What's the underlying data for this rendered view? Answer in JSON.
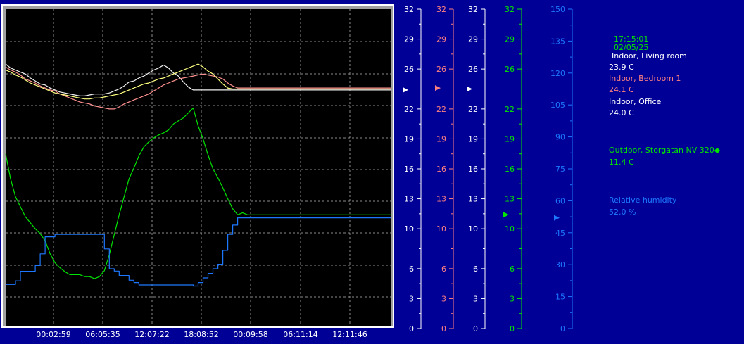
{
  "colors": {
    "background": "#000096",
    "plot_background": "#000000",
    "grid": "#8a8a8a",
    "living_room": "#f0f0f0",
    "bedroom": "#ff9090",
    "office": "#ffff80",
    "outdoor": "#00e600",
    "humidity": "#1e78ff"
  },
  "readouts": {
    "time": "17:15:01",
    "date": "02/05/25",
    "sensors": [
      {
        "name": "Indoor, Living room",
        "value": "23.9  C",
        "color": "#ffffff"
      },
      {
        "name": "Indoor, Bedroom 1",
        "value": "24.1  C",
        "color": "#ff8080"
      },
      {
        "name": "Indoor, Office",
        "value": "24.0  C",
        "color": "#ffffff"
      },
      {
        "name": "Outdoor, Storgatan NV 320◆",
        "value": "11.4  C",
        "color": "#00e600"
      },
      {
        "name": "Relative humidity",
        "value": "52.0 %",
        "color": "#1e78ff"
      }
    ]
  },
  "chart_data": {
    "type": "line",
    "x_ticks": [
      "00:02:59",
      "06:05:35",
      "12:07:22",
      "18:08:52",
      "00:09:58",
      "06:11:14",
      "12:11:46"
    ],
    "x": [
      0,
      1,
      2,
      3,
      4,
      5,
      6,
      7,
      8,
      9,
      10,
      11,
      12,
      13,
      14,
      15,
      16,
      17,
      18,
      19,
      20,
      21,
      22,
      23,
      24,
      25,
      26,
      27,
      28,
      29,
      30,
      31,
      32,
      33,
      34,
      35,
      36,
      37,
      38,
      39,
      40,
      41,
      42,
      43,
      44,
      45,
      46,
      47,
      48,
      49,
      50,
      51,
      52,
      53,
      54,
      55,
      56,
      57,
      58,
      59,
      60,
      61,
      62,
      63,
      64,
      65,
      66,
      67,
      68,
      69,
      70,
      71,
      72,
      73,
      74,
      75,
      76,
      77,
      78
    ],
    "xlim": [
      0,
      78
    ],
    "axes": [
      {
        "color": "#ffffff",
        "ylim": [
          0,
          32
        ],
        "ticks": [
          0,
          3,
          6,
          10,
          13,
          16,
          19,
          22,
          26,
          29,
          32
        ],
        "marker": 23.9
      },
      {
        "color": "#ff8080",
        "ylim": [
          0,
          32
        ],
        "ticks": [
          0,
          3,
          6,
          10,
          13,
          16,
          19,
          22,
          26,
          29,
          32
        ],
        "marker": 24.1
      },
      {
        "color": "#ffffff",
        "ylim": [
          0,
          32
        ],
        "ticks": [
          0,
          3,
          6,
          10,
          13,
          16,
          19,
          22,
          26,
          29,
          32
        ],
        "marker": 24.0
      },
      {
        "color": "#00e600",
        "ylim": [
          0,
          32
        ],
        "ticks": [
          0,
          3,
          6,
          10,
          13,
          16,
          19,
          22,
          26,
          29,
          32
        ],
        "marker": 11.4
      },
      {
        "color": "#1e78ff",
        "ylim": [
          0,
          150
        ],
        "ticks": [
          0,
          15,
          30,
          45,
          60,
          75,
          90,
          105,
          120,
          135,
          150
        ],
        "marker": 52.0
      }
    ],
    "series": [
      {
        "name": "Indoor, Living room",
        "axis": 0,
        "color": "#f0f0f0",
        "values": [
          26.5,
          26.1,
          25.9,
          25.7,
          25.5,
          25.1,
          24.8,
          24.5,
          24.4,
          24.1,
          23.9,
          23.7,
          23.6,
          23.5,
          23.4,
          23.3,
          23.3,
          23.4,
          23.5,
          23.5,
          23.5,
          23.6,
          23.8,
          24.0,
          24.3,
          24.7,
          24.8,
          25.1,
          25.3,
          25.6,
          25.9,
          26.1,
          26.4,
          26.1,
          25.6,
          25.3,
          24.7,
          24.2,
          23.9,
          23.9,
          23.9,
          23.9,
          23.9,
          23.9,
          23.9,
          23.9,
          23.9,
          23.9,
          23.9,
          23.9,
          23.9,
          23.9,
          23.9,
          23.9,
          23.9,
          23.9,
          23.9,
          23.9,
          23.9,
          23.9,
          23.9,
          23.9,
          23.9,
          23.9,
          23.9,
          23.9,
          23.9,
          23.9,
          23.9,
          23.9,
          23.9,
          23.9,
          23.9,
          23.9,
          23.9,
          23.9,
          23.9,
          23.9,
          23.9
        ]
      },
      {
        "name": "Indoor, Bedroom 1",
        "axis": 1,
        "color": "#ff9090",
        "values": [
          26.2,
          25.9,
          25.7,
          25.4,
          25.0,
          24.8,
          24.6,
          24.3,
          24.1,
          23.9,
          23.8,
          23.5,
          23.3,
          23.1,
          22.9,
          22.7,
          22.6,
          22.5,
          22.3,
          22.2,
          22.1,
          22.0,
          22.0,
          22.2,
          22.5,
          22.7,
          22.9,
          23.1,
          23.3,
          23.5,
          23.8,
          24.1,
          24.4,
          24.6,
          24.8,
          25.0,
          25.1,
          25.2,
          25.3,
          25.4,
          25.5,
          25.4,
          25.3,
          25.2,
          25.0,
          24.6,
          24.3,
          24.1,
          24.1,
          24.1,
          24.1,
          24.1,
          24.1,
          24.1,
          24.1,
          24.1,
          24.1,
          24.1,
          24.1,
          24.1,
          24.1,
          24.1,
          24.1,
          24.1,
          24.1,
          24.1,
          24.1,
          24.1,
          24.1,
          24.1,
          24.1,
          24.1,
          24.1,
          24.1,
          24.1,
          24.1,
          24.1,
          24.1,
          24.1
        ]
      },
      {
        "name": "Indoor, Office",
        "axis": 2,
        "color": "#ffff80",
        "values": [
          25.9,
          25.7,
          25.4,
          25.2,
          24.9,
          24.6,
          24.4,
          24.2,
          24.0,
          23.8,
          23.6,
          23.5,
          23.4,
          23.3,
          23.2,
          23.1,
          23.0,
          23.0,
          23.1,
          23.1,
          23.2,
          23.3,
          23.4,
          23.5,
          23.7,
          23.9,
          24.1,
          24.3,
          24.5,
          24.6,
          24.8,
          25.0,
          25.1,
          25.3,
          25.5,
          25.7,
          25.9,
          26.1,
          26.3,
          26.5,
          26.2,
          25.8,
          25.5,
          25.0,
          24.5,
          24.1,
          24.0,
          24.0,
          24.0,
          24.0,
          24.0,
          24.0,
          24.0,
          24.0,
          24.0,
          24.0,
          24.0,
          24.0,
          24.0,
          24.0,
          24.0,
          24.0,
          24.0,
          24.0,
          24.0,
          24.0,
          24.0,
          24.0,
          24.0,
          24.0,
          24.0,
          24.0,
          24.0,
          24.0,
          24.0,
          24.0,
          24.0,
          24.0,
          24.0
        ]
      },
      {
        "name": "Outdoor, Storgatan NV 320◆",
        "axis": 3,
        "color": "#00e600",
        "values": [
          17.5,
          15.0,
          13.2,
          12.2,
          11.2,
          10.6,
          10.0,
          9.5,
          8.8,
          7.5,
          6.6,
          6.1,
          5.7,
          5.4,
          5.4,
          5.4,
          5.2,
          5.2,
          5.0,
          5.2,
          5.8,
          7.4,
          9.4,
          11.4,
          13.2,
          15.0,
          16.1,
          17.3,
          18.2,
          18.7,
          19.1,
          19.4,
          19.6,
          19.9,
          20.5,
          20.8,
          21.1,
          21.6,
          22.1,
          20.3,
          19.0,
          17.4,
          16.0,
          15.1,
          14.1,
          13.0,
          12.0,
          11.4,
          11.6,
          11.4,
          11.4,
          11.4,
          11.4,
          11.4,
          11.4,
          11.4,
          11.4,
          11.4,
          11.4,
          11.4,
          11.4,
          11.4,
          11.4,
          11.4,
          11.4,
          11.4,
          11.4,
          11.4,
          11.4,
          11.4,
          11.4,
          11.4,
          11.4,
          11.4,
          11.4,
          11.4,
          11.4,
          11.4,
          11.4
        ]
      },
      {
        "name": "Relative humidity",
        "axis": 4,
        "color": "#1e78ff",
        "values": [
          20.7,
          20.7,
          22.4,
          26.9,
          26.9,
          26.9,
          29.6,
          35.1,
          43.1,
          43.1,
          44.2,
          44.2,
          44.2,
          44.2,
          44.2,
          44.2,
          44.2,
          44.2,
          44.2,
          44.2,
          37.4,
          28.1,
          27.0,
          24.9,
          24.9,
          22.7,
          21.6,
          20.5,
          20.5,
          20.5,
          20.5,
          20.5,
          20.5,
          20.5,
          20.5,
          20.5,
          20.5,
          20.5,
          20.0,
          21.6,
          23.8,
          25.9,
          28.1,
          30.2,
          36.7,
          44.2,
          48.6,
          52.0,
          52.0,
          52.0,
          52.0,
          52.0,
          52.0,
          52.0,
          52.0,
          52.0,
          52.0,
          52.0,
          52.0,
          52.0,
          52.0,
          52.0,
          52.0,
          52.0,
          52.0,
          52.0,
          52.0,
          52.0,
          52.0,
          52.0,
          52.0,
          52.0,
          52.0,
          52.0,
          52.0,
          52.0,
          52.0,
          52.0,
          52.0
        ]
      }
    ]
  }
}
